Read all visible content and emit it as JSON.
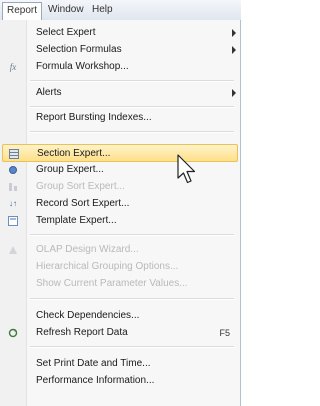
{
  "menubar": {
    "report": "Report",
    "window": "Window",
    "help": "Help"
  },
  "menu": {
    "select_expert": "Select Expert",
    "selection_formulas": "Selection Formulas",
    "formula_workshop": "Formula Workshop...",
    "alerts": "Alerts",
    "report_bursting_indexes": "Report Bursting Indexes...",
    "section_expert": "Section Expert...",
    "group_expert": "Group Expert...",
    "group_sort_expert": "Group Sort Expert...",
    "record_sort_expert": "Record Sort Expert...",
    "template_expert": "Template Expert...",
    "olap_design_wizard": "OLAP Design Wizard...",
    "hierarchical_grouping_options": "Hierarchical Grouping Options...",
    "show_current_parameter_values": "Show Current Parameter Values...",
    "check_dependencies": "Check Dependencies...",
    "refresh_report_data": "Refresh Report Data",
    "refresh_shortcut": "F5",
    "set_print_date_and_time": "Set Print Date and Time...",
    "performance_information": "Performance Information..."
  },
  "colors": {
    "highlight": "#ffe08a",
    "disabled_text": "#b9b9b9"
  }
}
